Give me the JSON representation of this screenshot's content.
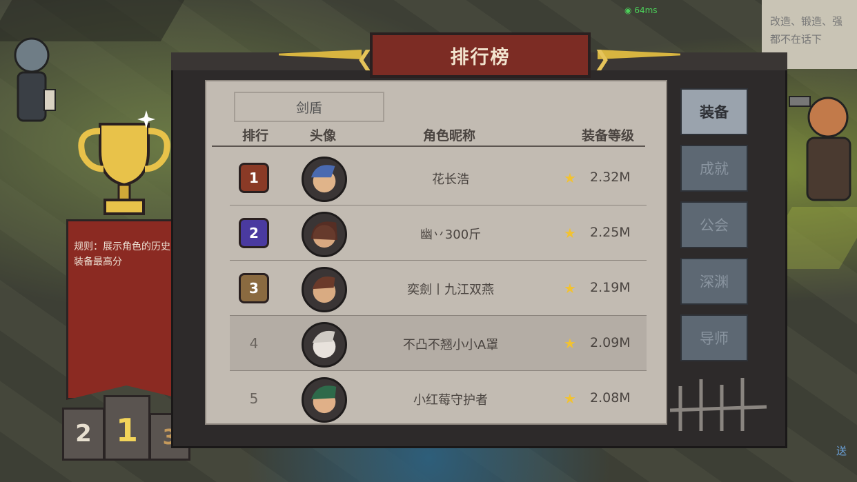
{
  "status": {
    "ping": "64ms"
  },
  "background_note": {
    "line1": "改造、锻造、强",
    "line2": "都不在话下"
  },
  "corner_text": "送",
  "title": "排行榜",
  "rules": "规则：展示角色的历史装备最高分",
  "podium": {
    "first": "1",
    "second": "2",
    "third": "3"
  },
  "filter_tab": "剑盾",
  "columns": {
    "rank": "排行",
    "avatar": "头像",
    "name": "角色昵称",
    "score": "装备等级"
  },
  "rows": [
    {
      "rank": "1",
      "name": "花长浩",
      "score": "2.32M",
      "badge_color": "#8a3a26"
    },
    {
      "rank": "2",
      "name": "幽丷300斤",
      "score": "2.25M",
      "badge_color": "#4a3aa0"
    },
    {
      "rank": "3",
      "name": "奕劍丨九江双燕",
      "score": "2.19M",
      "badge_color": "#8a6a40"
    },
    {
      "rank": "4",
      "name": "不凸不翘小小A罩",
      "score": "2.09M"
    },
    {
      "rank": "5",
      "name": "小红莓守护者",
      "score": "2.08M"
    }
  ],
  "side_tabs": [
    {
      "label": "装备",
      "active": true
    },
    {
      "label": "成就",
      "active": false
    },
    {
      "label": "公会",
      "active": false
    },
    {
      "label": "深渊",
      "active": false
    },
    {
      "label": "导师",
      "active": false
    }
  ],
  "colors": {
    "ribbon": "#7c2c24",
    "gold": "#d8b540",
    "paper": "#c2bbb2",
    "star": "#f1c232"
  }
}
